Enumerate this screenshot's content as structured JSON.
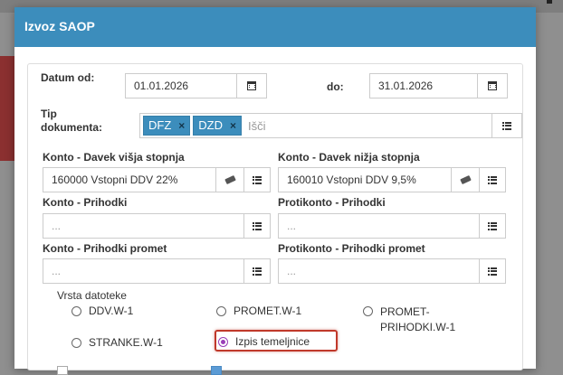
{
  "modal": {
    "title": "Izvoz SAOP"
  },
  "datum": {
    "od_label": "Datum od:",
    "od_value": "01.01.2026",
    "do_label": "do:",
    "do_value": "31.01.2026"
  },
  "tip": {
    "label_line1": "Tip",
    "label_line2": "dokumenta:",
    "tags": [
      "DFZ",
      "DZD"
    ],
    "remove_glyph": "×",
    "search_placeholder": "Išči"
  },
  "konto_visja": {
    "label": "Konto - Davek višja stopnja",
    "value": "160000 Vstopni DDV 22%"
  },
  "konto_nizja": {
    "label": "Konto - Davek nižja stopnja",
    "value": "160010 Vstopni DDV 9,5%"
  },
  "konto_prihodki": {
    "label": "Konto - Prihodki",
    "placeholder": "..."
  },
  "protikonto_prihodki": {
    "label": "Protikonto - Prihodki",
    "placeholder": "..."
  },
  "konto_prihodki_promet": {
    "label": "Konto - Prihodki promet",
    "placeholder": "..."
  },
  "protikonto_prihodki_promet": {
    "label": "Protikonto - Prihodki promet",
    "placeholder": "..."
  },
  "vrsta": {
    "label": "Vrsta datoteke",
    "options": [
      {
        "label": "DDV.W-1",
        "checked": false
      },
      {
        "label": "PROMET.W-1",
        "checked": false
      },
      {
        "label_line1": "PROMET-",
        "label_line2": "PRIHODKI.W-1",
        "checked": false
      },
      {
        "label": "STRANKE.W-1",
        "checked": false
      },
      {
        "label": "Izpis temeljnice",
        "checked": true
      }
    ]
  },
  "colors": {
    "header": "#3c8dbc",
    "tag": "#3c8dbc",
    "radio_checked": "#9a3fb8",
    "highlight": "#c0392b"
  },
  "icons": {
    "calendar": "calendar-icon",
    "list": "list-icon",
    "eraser": "eraser-icon"
  }
}
